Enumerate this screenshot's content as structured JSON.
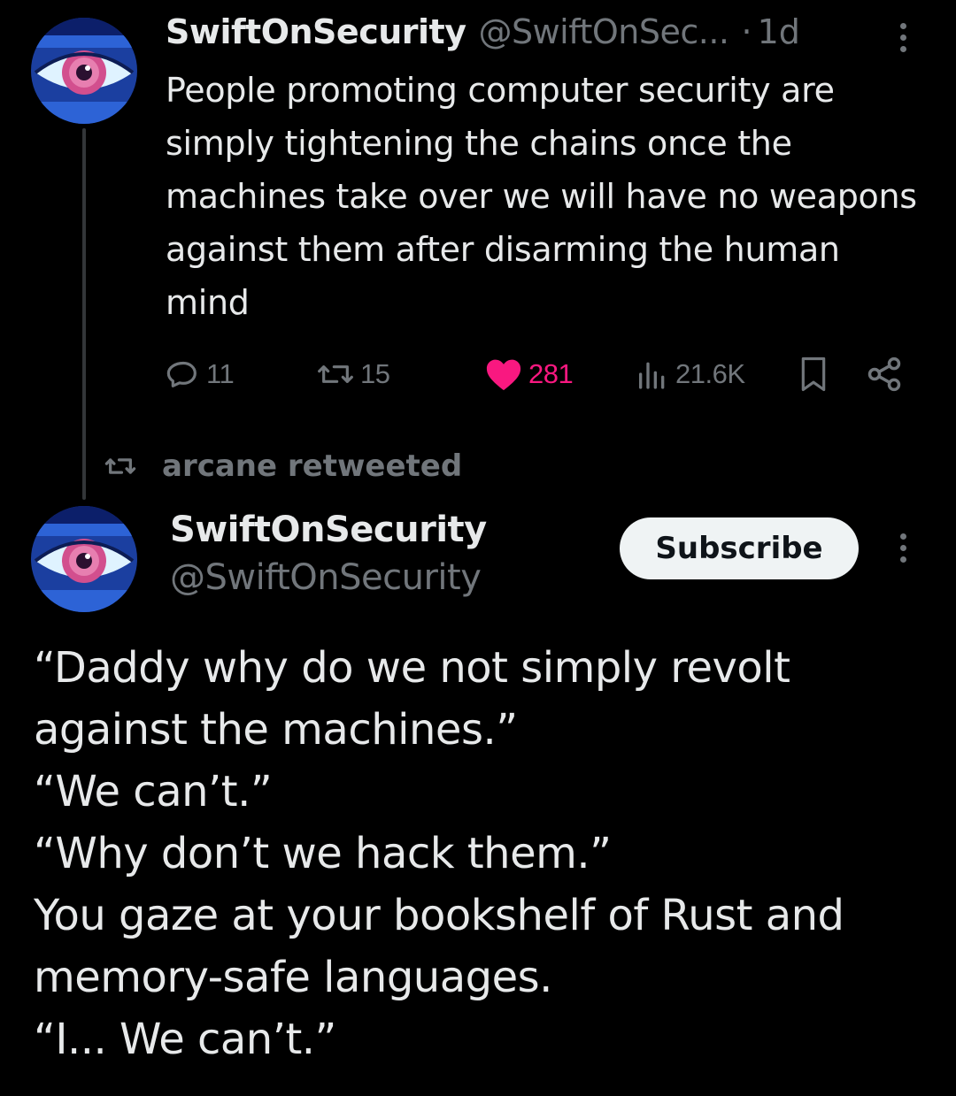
{
  "tweet1": {
    "author_name": "SwiftOnSecurity",
    "author_handle": "@SwiftOnSec...",
    "separator": "·",
    "time": "1d",
    "text": "People promoting computer security are simply tightening the chains once the machines take over we will have no weapons against them after disarming the human mind",
    "avatar_icon": "eye-avatar-icon",
    "actions": {
      "replies": "11",
      "retweets": "15",
      "likes": "281",
      "views": "21.6K"
    },
    "like_color": "#f91880"
  },
  "retweet_context": {
    "label": "arcane retweeted"
  },
  "tweet2": {
    "author_name": "SwiftOnSecurity",
    "author_handle": "@SwiftOnSecurity",
    "subscribe_label": "Subscribe",
    "avatar_icon": "eye-avatar-icon",
    "lines": [
      "“Daddy why do we not simply revolt",
      "against the machines.”",
      "“We can’t.”",
      "“Why don’t we hack them.”",
      "You gaze at your bookshelf of Rust and",
      "memory-safe languages.",
      "“I... We can’t.”"
    ]
  },
  "colors": {
    "background": "#000000",
    "primary_text": "#e7e9ea",
    "secondary_text": "#71767b",
    "button_bg": "#eff3f4"
  }
}
